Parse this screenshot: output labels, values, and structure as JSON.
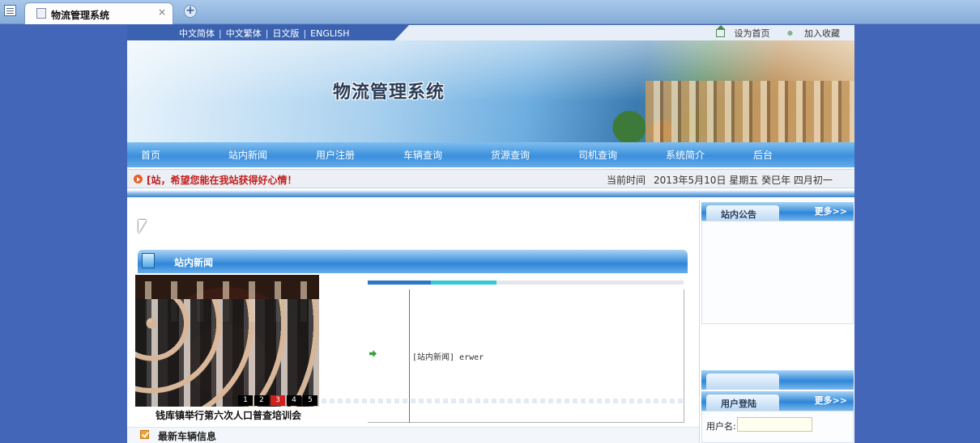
{
  "browser": {
    "tab_title": "物流管理系统",
    "tab_close": "×",
    "new_tab": "+"
  },
  "topbar": {
    "languages": [
      "中文简体",
      "中文繁体",
      "日文版",
      "ENGLISH"
    ],
    "separator": "|",
    "set_home": "设为首页",
    "add_favorite": "加入收藏"
  },
  "banner": {
    "site_title": "物流管理系统"
  },
  "nav": {
    "items": [
      "首页",
      "站内新闻",
      "用户注册",
      "车辆查询",
      "货源查询",
      "司机查询",
      "系统简介",
      "后台"
    ]
  },
  "ticker": {
    "message": "[站，希望您能在我站获得好心情！",
    "time_label": "当前时间",
    "time_value": "2013年5月10日  星期五  癸巳年  四月初一"
  },
  "news": {
    "section_title": "站内新闻",
    "photo_caption": "钱库镇举行第六次人口普查培训会",
    "photo_pager": [
      "1",
      "2",
      "3",
      "4",
      "5"
    ],
    "photo_active_page": "3",
    "list": [
      {
        "text": "[站内新闻] erwer"
      }
    ]
  },
  "vehicles": {
    "section_title": "最新车辆信息"
  },
  "sidebar": {
    "notice_title": "站内公告",
    "notice_more": "更多>>",
    "login_title": "用户登陆",
    "login_more": "更多>>",
    "username_label": "用户名:",
    "username_value": ""
  },
  "colors": {
    "page_bg": "#4466b8",
    "nav_blue": "#3b8fdc",
    "ticker_red": "#c21e1e"
  }
}
